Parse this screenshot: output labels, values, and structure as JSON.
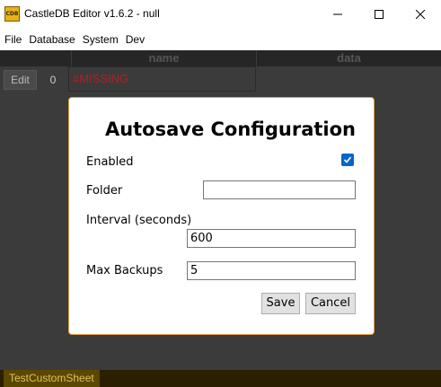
{
  "window": {
    "title": "CastleDB Editor v1.6.2 - null",
    "app_icon": "castledb-logo-icon",
    "app_icon_text": "CDB"
  },
  "menu": {
    "items": [
      "File",
      "Database",
      "System",
      "Dev"
    ]
  },
  "sheet": {
    "columns": [
      "name",
      "data"
    ],
    "rows": [
      {
        "edit_label": "Edit",
        "index": "0",
        "name": "#MISSING",
        "data": ""
      }
    ],
    "tabs": [
      "TestCustomSheet"
    ]
  },
  "dialog": {
    "title": "Autosave Configuration",
    "enabled_label": "Enabled",
    "enabled_checked": true,
    "folder_label": "Folder",
    "folder_value": "",
    "interval_label": "Interval (seconds)",
    "interval_value": "600",
    "backups_label": "Max Backups",
    "backups_value": "5",
    "save_label": "Save",
    "cancel_label": "Cancel"
  },
  "colors": {
    "accent": "#0a64c8",
    "modal_border": "#e0a040",
    "missing_text": "#b02020",
    "app_background": "#3b3b3b"
  }
}
